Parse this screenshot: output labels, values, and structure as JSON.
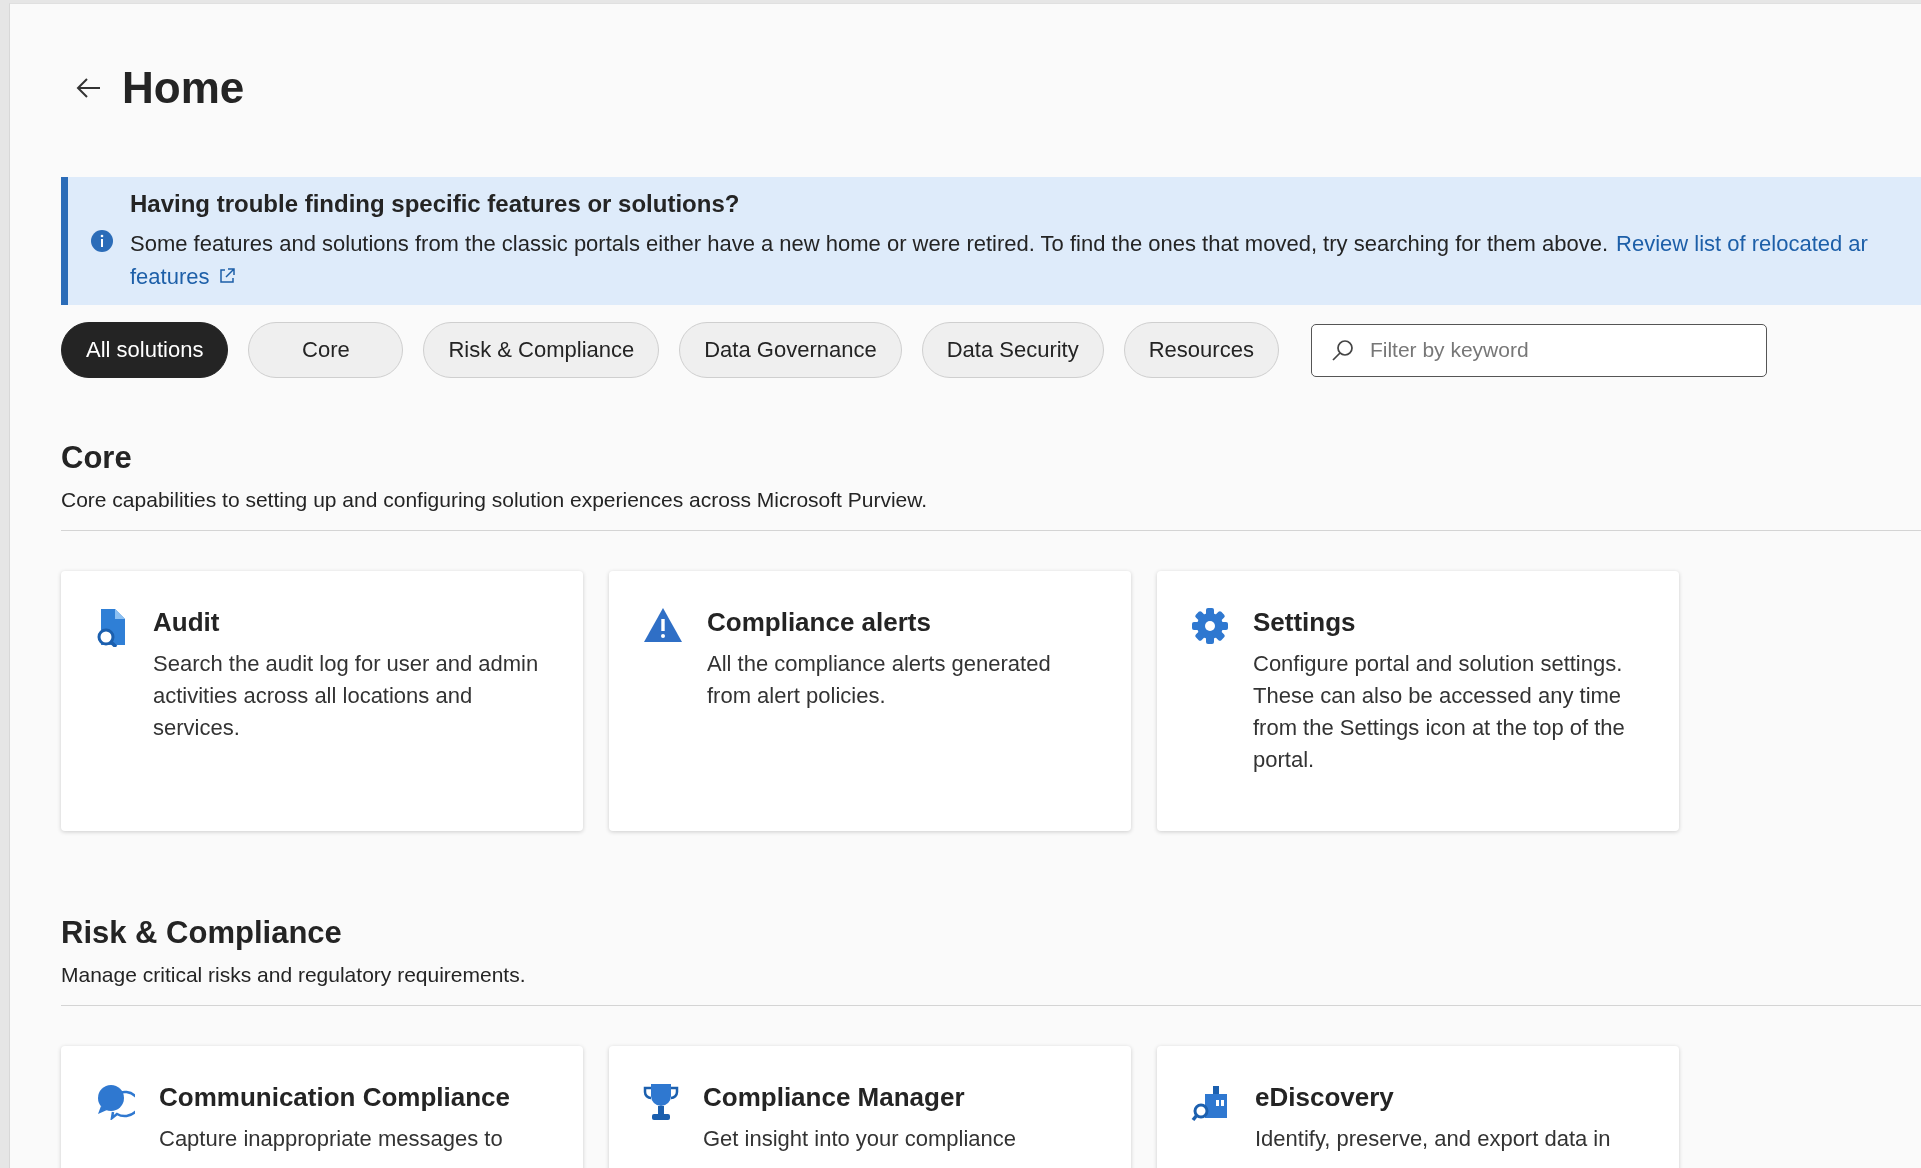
{
  "page": {
    "title": "Home"
  },
  "banner": {
    "title": "Having trouble finding specific features or solutions?",
    "text": "Some features and solutions from the classic portals either have a new home or were retired. To find the ones that moved, try searching for them above.",
    "link_line1": "Review list of relocated ar",
    "link_line2": "features"
  },
  "chips": [
    {
      "label": "All solutions",
      "selected": true
    },
    {
      "label": "Core",
      "selected": false
    },
    {
      "label": "Risk & Compliance",
      "selected": false
    },
    {
      "label": "Data Governance",
      "selected": false
    },
    {
      "label": "Data Security",
      "selected": false
    },
    {
      "label": "Resources",
      "selected": false
    }
  ],
  "filter": {
    "placeholder": "Filter by keyword"
  },
  "sections": [
    {
      "title": "Core",
      "description": "Core capabilities to setting up and configuring solution experiences across Microsoft Purview.",
      "cards": [
        {
          "kind": "audit",
          "title": "Audit",
          "description": "Search the audit log for user and admin activities across all locations and services."
        },
        {
          "kind": "alert",
          "title": "Compliance alerts",
          "description": "All the compliance alerts generated from alert policies."
        },
        {
          "kind": "settings",
          "title": "Settings",
          "description": "Configure portal and solution settings. These can also be accessed any time from the Settings icon at the top of the portal."
        }
      ]
    },
    {
      "title": "Risk & Compliance",
      "description": "Manage critical risks and regulatory requirements.",
      "cards": [
        {
          "kind": "chat",
          "title": "Communication Compliance",
          "description": "Capture inappropriate messages to"
        },
        {
          "kind": "trophy",
          "title": "Compliance Manager",
          "description": "Get insight into your compliance"
        },
        {
          "kind": "discovery",
          "title": "eDiscovery",
          "description": "Identify, preserve, and export data in"
        }
      ]
    }
  ]
}
